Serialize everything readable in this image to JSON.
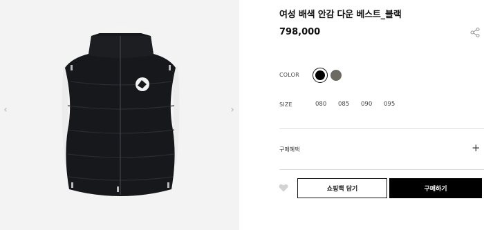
{
  "gallery": {
    "prev_icon": "chevron-left-icon",
    "next_icon": "chevron-right-icon",
    "prev_glyph": "‹",
    "next_glyph": "›"
  },
  "product": {
    "title": "여성 배색 안감 다운 베스트_블랙",
    "price": "798,000",
    "share_icon": "share-icon"
  },
  "options": {
    "color_label": "COLOR",
    "colors": [
      {
        "name": "black",
        "hex": "#000000",
        "selected": true
      },
      {
        "name": "gray",
        "hex": "#6b6b63",
        "selected": false
      }
    ],
    "size_label": "SIZE",
    "sizes": [
      "080",
      "085",
      "090",
      "095"
    ]
  },
  "benefit": {
    "label": "구매혜택",
    "expand_glyph": "+"
  },
  "actions": {
    "wishlist_icon": "heart-icon",
    "cart_label": "쇼핑백 담기",
    "buy_label": "구매하기"
  }
}
